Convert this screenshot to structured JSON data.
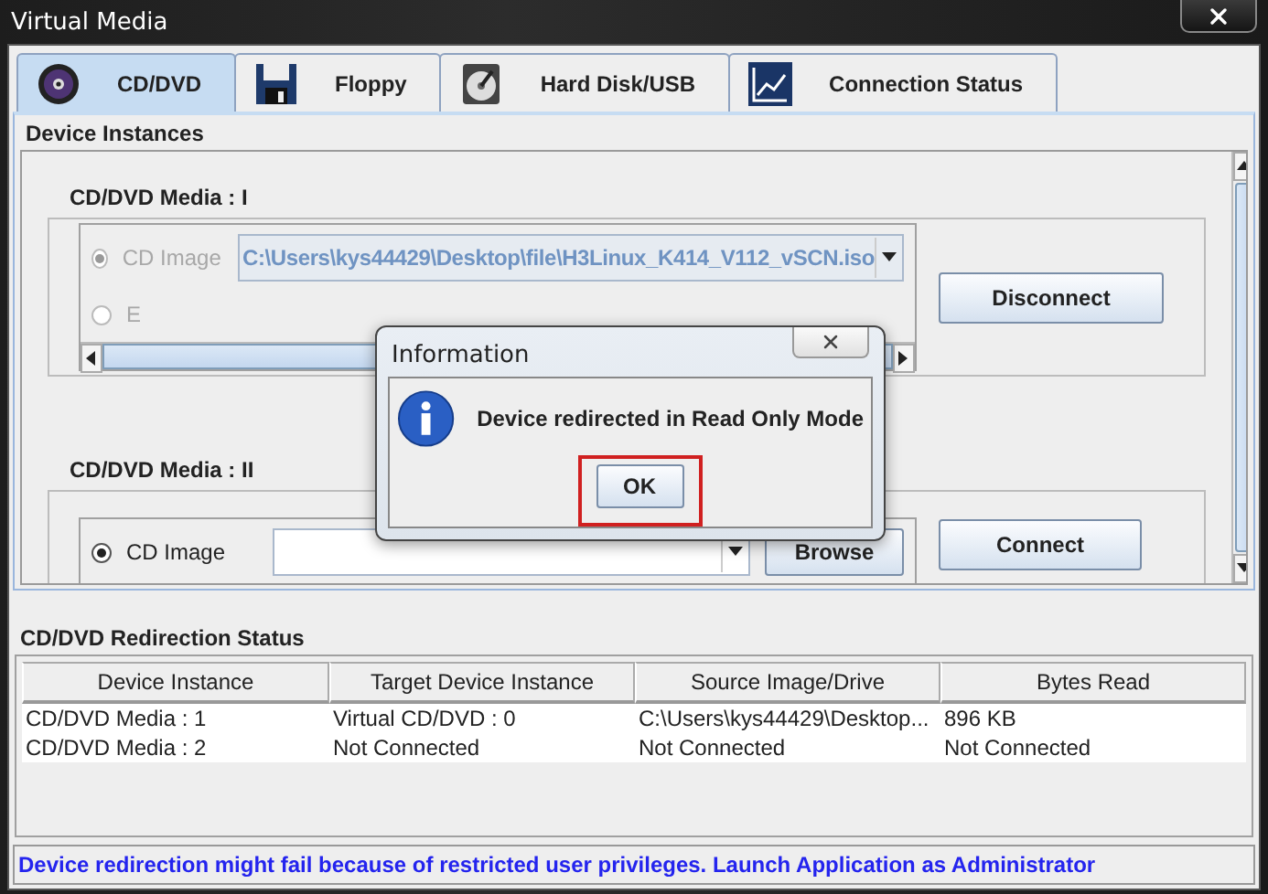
{
  "window": {
    "title": "Virtual Media"
  },
  "tabs": [
    {
      "label": "CD/DVD",
      "kind": "disc",
      "selected": true
    },
    {
      "label": "Floppy",
      "kind": "floppy",
      "selected": false
    },
    {
      "label": "Hard Disk/USB",
      "kind": "harddisk",
      "selected": false
    },
    {
      "label": "Connection Status",
      "kind": "chart",
      "selected": false
    }
  ],
  "device_instances": {
    "title": "Device Instances",
    "groups": [
      {
        "title": "CD/DVD Media : I",
        "kind": "connected",
        "disabled": true,
        "path": "C:\\Users\\kys44429\\Desktop\\file\\H3Linux_K414_V112_vSCN.iso",
        "options": [
          {
            "label": "CD Image",
            "selected": true
          },
          {
            "label": "E",
            "selected": false
          }
        ],
        "button": "Disconnect"
      },
      {
        "title": "CD/DVD Media : II",
        "kind": "idle",
        "disabled": false,
        "options": [
          {
            "label": "CD Image",
            "selected": true
          }
        ],
        "browse": "Browse",
        "button": "Connect"
      }
    ]
  },
  "redirection_status": {
    "title": "CD/DVD Redirection Status",
    "columns": [
      "Device Instance",
      "Target Device Instance",
      "Source Image/Drive",
      "Bytes Read"
    ],
    "rows": [
      [
        "CD/DVD Media :  1",
        "Virtual CD/DVD : 0",
        "C:\\Users\\kys44429\\Desktop...",
        "896 KB"
      ],
      [
        "CD/DVD Media :  2",
        "Not Connected",
        "Not Connected",
        "Not Connected"
      ]
    ]
  },
  "status_bar": "Device redirection might fail because of restricted user privileges. Launch Application as Administrator",
  "dialog": {
    "title": "Information",
    "message": "Device redirected in Read Only Mode",
    "button": "OK",
    "highlighted": true
  }
}
